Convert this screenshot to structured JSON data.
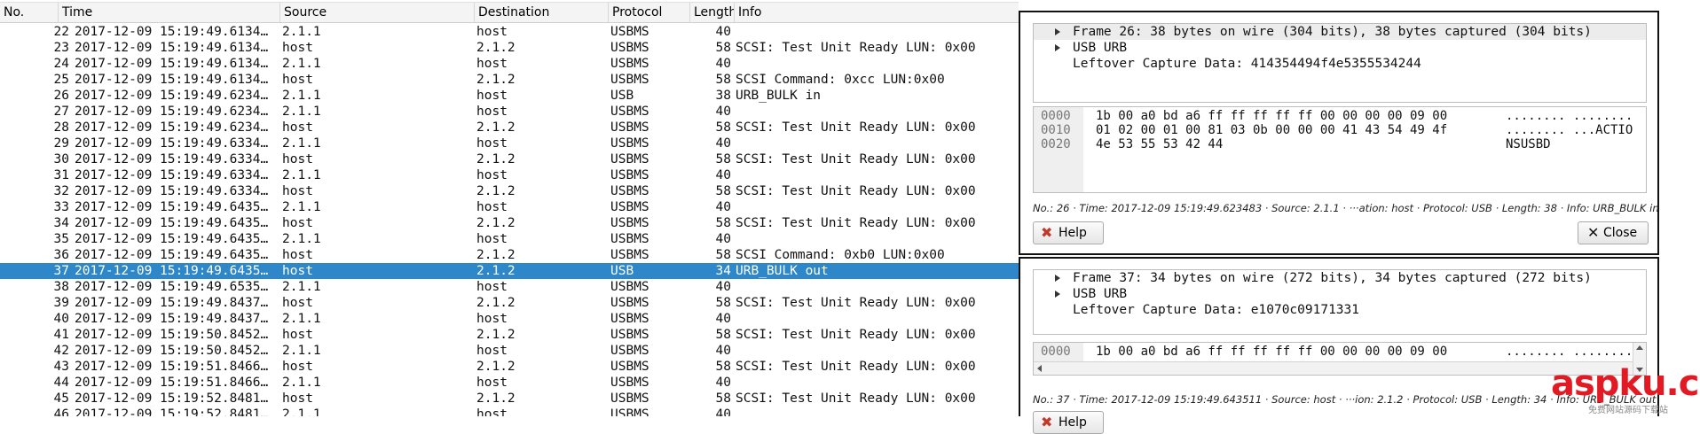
{
  "columns": {
    "no": "No.",
    "time": "Time",
    "source": "Source",
    "destination": "Destination",
    "protocol": "Protocol",
    "length": "Length",
    "info": "Info"
  },
  "packets": [
    {
      "no": "22",
      "time": "2017-12-09 15:19:49.6134…",
      "source": "2.1.1",
      "destination": "host",
      "protocol": "USBMS",
      "length": "40",
      "info": ""
    },
    {
      "no": "23",
      "time": "2017-12-09 15:19:49.6134…",
      "source": "host",
      "destination": "2.1.2",
      "protocol": "USBMS",
      "length": "58",
      "info": "SCSI: Test Unit Ready LUN: 0x00"
    },
    {
      "no": "24",
      "time": "2017-12-09 15:19:49.6134…",
      "source": "2.1.1",
      "destination": "host",
      "protocol": "USBMS",
      "length": "40",
      "info": ""
    },
    {
      "no": "25",
      "time": "2017-12-09 15:19:49.6134…",
      "source": "host",
      "destination": "2.1.2",
      "protocol": "USBMS",
      "length": "58",
      "info": "SCSI Command: 0xcc LUN:0x00"
    },
    {
      "no": "26",
      "time": "2017-12-09 15:19:49.6234…",
      "source": "2.1.1",
      "destination": "host",
      "protocol": "USB",
      "length": "38",
      "info": "URB_BULK in"
    },
    {
      "no": "27",
      "time": "2017-12-09 15:19:49.6234…",
      "source": "2.1.1",
      "destination": "host",
      "protocol": "USBMS",
      "length": "40",
      "info": ""
    },
    {
      "no": "28",
      "time": "2017-12-09 15:19:49.6234…",
      "source": "host",
      "destination": "2.1.2",
      "protocol": "USBMS",
      "length": "58",
      "info": "SCSI: Test Unit Ready LUN: 0x00"
    },
    {
      "no": "29",
      "time": "2017-12-09 15:19:49.6334…",
      "source": "2.1.1",
      "destination": "host",
      "protocol": "USBMS",
      "length": "40",
      "info": ""
    },
    {
      "no": "30",
      "time": "2017-12-09 15:19:49.6334…",
      "source": "host",
      "destination": "2.1.2",
      "protocol": "USBMS",
      "length": "58",
      "info": "SCSI: Test Unit Ready LUN: 0x00"
    },
    {
      "no": "31",
      "time": "2017-12-09 15:19:49.6334…",
      "source": "2.1.1",
      "destination": "host",
      "protocol": "USBMS",
      "length": "40",
      "info": ""
    },
    {
      "no": "32",
      "time": "2017-12-09 15:19:49.6334…",
      "source": "host",
      "destination": "2.1.2",
      "protocol": "USBMS",
      "length": "58",
      "info": "SCSI: Test Unit Ready LUN: 0x00"
    },
    {
      "no": "33",
      "time": "2017-12-09 15:19:49.6435…",
      "source": "2.1.1",
      "destination": "host",
      "protocol": "USBMS",
      "length": "40",
      "info": ""
    },
    {
      "no": "34",
      "time": "2017-12-09 15:19:49.6435…",
      "source": "host",
      "destination": "2.1.2",
      "protocol": "USBMS",
      "length": "58",
      "info": "SCSI: Test Unit Ready LUN: 0x00"
    },
    {
      "no": "35",
      "time": "2017-12-09 15:19:49.6435…",
      "source": "2.1.1",
      "destination": "host",
      "protocol": "USBMS",
      "length": "40",
      "info": ""
    },
    {
      "no": "36",
      "time": "2017-12-09 15:19:49.6435…",
      "source": "host",
      "destination": "2.1.2",
      "protocol": "USBMS",
      "length": "58",
      "info": "SCSI Command: 0xb0 LUN:0x00"
    },
    {
      "no": "37",
      "time": "2017-12-09 15:19:49.6435…",
      "source": "host",
      "destination": "2.1.2",
      "protocol": "USB",
      "length": "34",
      "info": "URB_BULK out",
      "selected": true
    },
    {
      "no": "38",
      "time": "2017-12-09 15:19:49.6535…",
      "source": "2.1.1",
      "destination": "host",
      "protocol": "USBMS",
      "length": "40",
      "info": ""
    },
    {
      "no": "39",
      "time": "2017-12-09 15:19:49.8437…",
      "source": "host",
      "destination": "2.1.2",
      "protocol": "USBMS",
      "length": "58",
      "info": "SCSI: Test Unit Ready LUN: 0x00"
    },
    {
      "no": "40",
      "time": "2017-12-09 15:19:49.8437…",
      "source": "2.1.1",
      "destination": "host",
      "protocol": "USBMS",
      "length": "40",
      "info": ""
    },
    {
      "no": "41",
      "time": "2017-12-09 15:19:50.8452…",
      "source": "host",
      "destination": "2.1.2",
      "protocol": "USBMS",
      "length": "58",
      "info": "SCSI: Test Unit Ready LUN: 0x00"
    },
    {
      "no": "42",
      "time": "2017-12-09 15:19:50.8452…",
      "source": "2.1.1",
      "destination": "host",
      "protocol": "USBMS",
      "length": "40",
      "info": ""
    },
    {
      "no": "43",
      "time": "2017-12-09 15:19:51.8466…",
      "source": "host",
      "destination": "2.1.2",
      "protocol": "USBMS",
      "length": "58",
      "info": "SCSI: Test Unit Ready LUN: 0x00"
    },
    {
      "no": "44",
      "time": "2017-12-09 15:19:51.8466…",
      "source": "2.1.1",
      "destination": "host",
      "protocol": "USBMS",
      "length": "40",
      "info": ""
    },
    {
      "no": "45",
      "time": "2017-12-09 15:19:52.8481…",
      "source": "host",
      "destination": "2.1.2",
      "protocol": "USBMS",
      "length": "58",
      "info": "SCSI: Test Unit Ready LUN: 0x00"
    },
    {
      "no": "46",
      "time": "2017-12-09 15:19:52.8481…",
      "source": "2.1.1",
      "destination": "host",
      "protocol": "USBMS",
      "length": "40",
      "info": ""
    }
  ],
  "detail_windows": [
    {
      "tree": [
        {
          "text": "Frame 26: 38 bytes on wire (304 bits), 38 bytes captured (304 bits)",
          "expandable": true
        },
        {
          "text": "USB URB",
          "expandable": true
        },
        {
          "text": "Leftover Capture Data: 414354494f4e5355534244",
          "expandable": false
        }
      ],
      "hex": [
        {
          "offset": "0000",
          "bytes": "1b 00 a0 bd a6 ff ff ff  ff ff 00 00 00 00 09 00",
          "ascii": "........ ........"
        },
        {
          "offset": "0010",
          "bytes": "01 02 00 01 00 81 03 0b  00 00 00 41 43 54 49 4f",
          "ascii": "........ ...ACTIO"
        },
        {
          "offset": "0020",
          "bytes": "4e 53 55 53 42 44",
          "ascii": "NSUSBD"
        }
      ],
      "status": "No.: 26 · Time: 2017-12-09 15:19:49.623483 · Source: 2.1.1 · ···ation: host · Protocol: USB · Length: 38 · Info: URB_BULK in",
      "help_label": "Help",
      "close_label": "Close"
    },
    {
      "tree": [
        {
          "text": "Frame 37: 34 bytes on wire (272 bits), 34 bytes captured (272 bits)",
          "expandable": true
        },
        {
          "text": "USB URB",
          "expandable": true
        },
        {
          "text": "Leftover Capture Data: e1070c09171331",
          "expandable": false
        }
      ],
      "hex": [
        {
          "offset": "0000",
          "bytes": "1b 00 a0 bd a6 ff ff ff  ff ff 00 00 00 00 09 00",
          "ascii": "........ ........"
        }
      ],
      "status": "No.: 37 · Time: 2017-12-09 15:19:49.643511 · Source: host · ···ion: 2.1.2 · Protocol: USB · Length: 34 · Info: URB_BULK out",
      "help_label": "Help"
    }
  ],
  "watermark": {
    "text": "aspku.com",
    "sub": "免费网站源码下载站"
  },
  "colors": {
    "selection": "#2e87c8",
    "help_icon": "#c0392b",
    "watermark": "#e21a24"
  }
}
